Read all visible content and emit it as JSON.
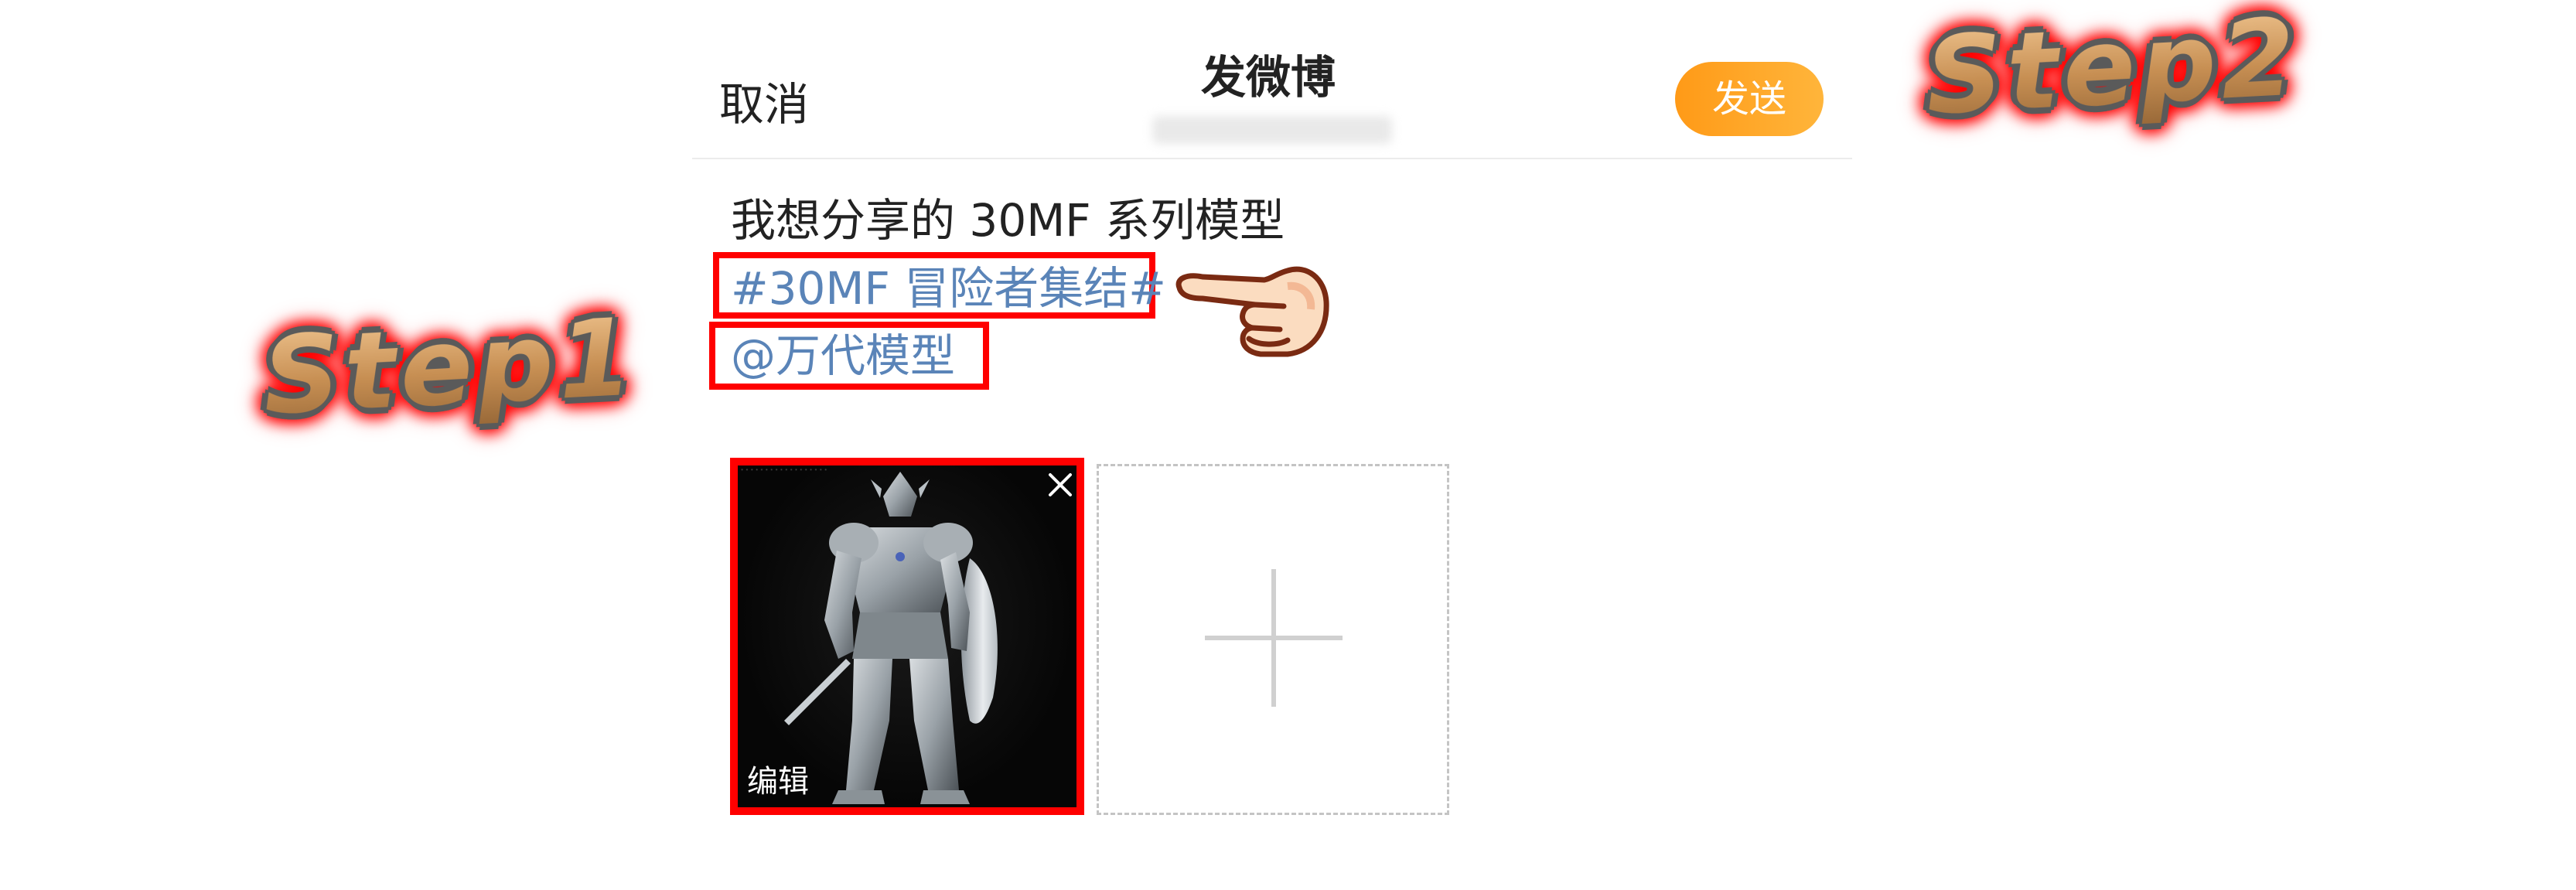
{
  "header": {
    "cancel_label": "取消",
    "title": "发微博",
    "send_label": "发送"
  },
  "compose": {
    "text_line": "我想分享的 30MF 系列模型",
    "topic_tag": "#30MF 冒险者集结#",
    "mention": "@万代模型"
  },
  "attachments": {
    "edit_label": "编辑"
  },
  "annotations": {
    "step1": "Step1",
    "step2": "Step2"
  },
  "icons": {
    "close": "close-icon",
    "add": "plus-icon",
    "pointer": "pointing-hand-icon"
  },
  "colors": {
    "accent_orange": "#ff9a17",
    "link_blue": "#5a84b8",
    "highlight_red": "#ff0000",
    "step_gold": "#d7a46a"
  }
}
